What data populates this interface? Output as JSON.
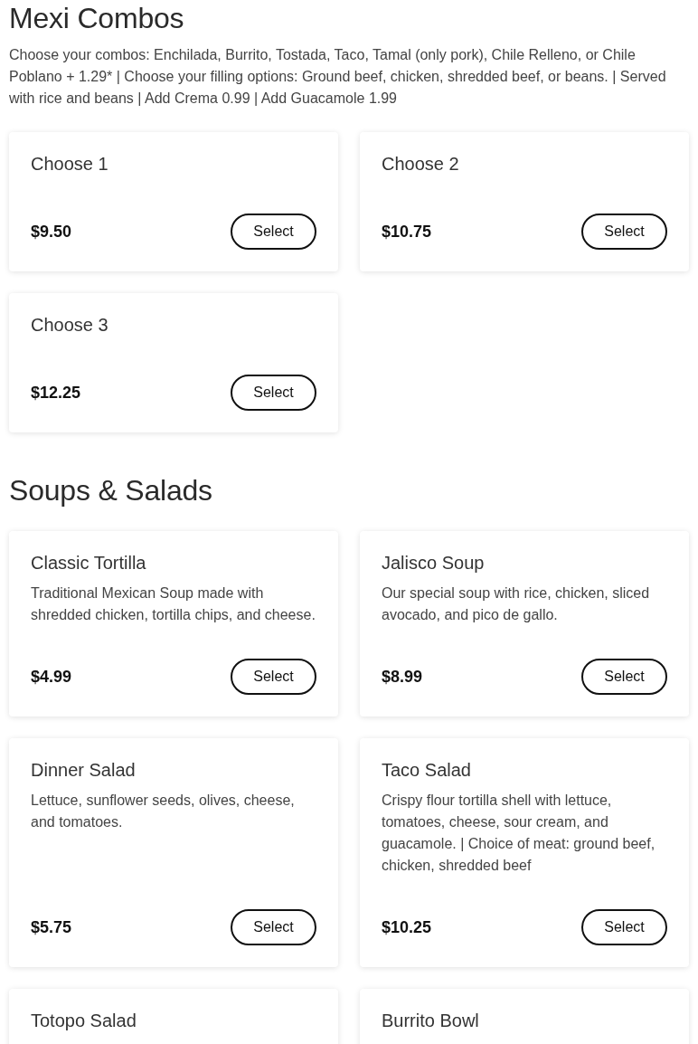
{
  "sections": [
    {
      "title": "Mexi Combos",
      "description": "Choose your combos: Enchilada, Burrito, Tostada, Taco, Tamal (only pork), Chile Relleno, or Chile Poblano + 1.29* | Choose your filling options: Ground beef, chicken, shredded beef, or beans. | Served with rice and beans | Add Crema 0.99 | Add Guacamole 1.99",
      "items": [
        {
          "name": "Choose 1",
          "price": "$9.50",
          "button": "Select"
        },
        {
          "name": "Choose 2",
          "price": "$10.75",
          "button": "Select"
        },
        {
          "name": "Choose 3",
          "price": "$12.25",
          "button": "Select"
        }
      ]
    },
    {
      "title": "Soups & Salads",
      "items": [
        {
          "name": "Classic Tortilla",
          "description": "Traditional Mexican Soup made with shredded chicken, tortilla chips, and cheese.",
          "price": "$4.99",
          "button": "Select"
        },
        {
          "name": "Jalisco Soup",
          "description": "Our special soup with rice, chicken, sliced avocado, and pico de gallo.",
          "price": "$8.99",
          "button": "Select"
        },
        {
          "name": "Dinner Salad",
          "description": "Lettuce, sunflower seeds, olives, cheese, and tomatoes.",
          "price": "$5.75",
          "button": "Select"
        },
        {
          "name": "Taco Salad",
          "description": "Crispy flour tortilla shell with lettuce, tomatoes, cheese, sour cream, and guacamole. | Choice of meat: ground beef, chicken, shredded beef",
          "price": "$10.25",
          "button": "Select"
        },
        {
          "name": "Totopo Salad"
        },
        {
          "name": "Burrito Bowl"
        }
      ]
    }
  ]
}
